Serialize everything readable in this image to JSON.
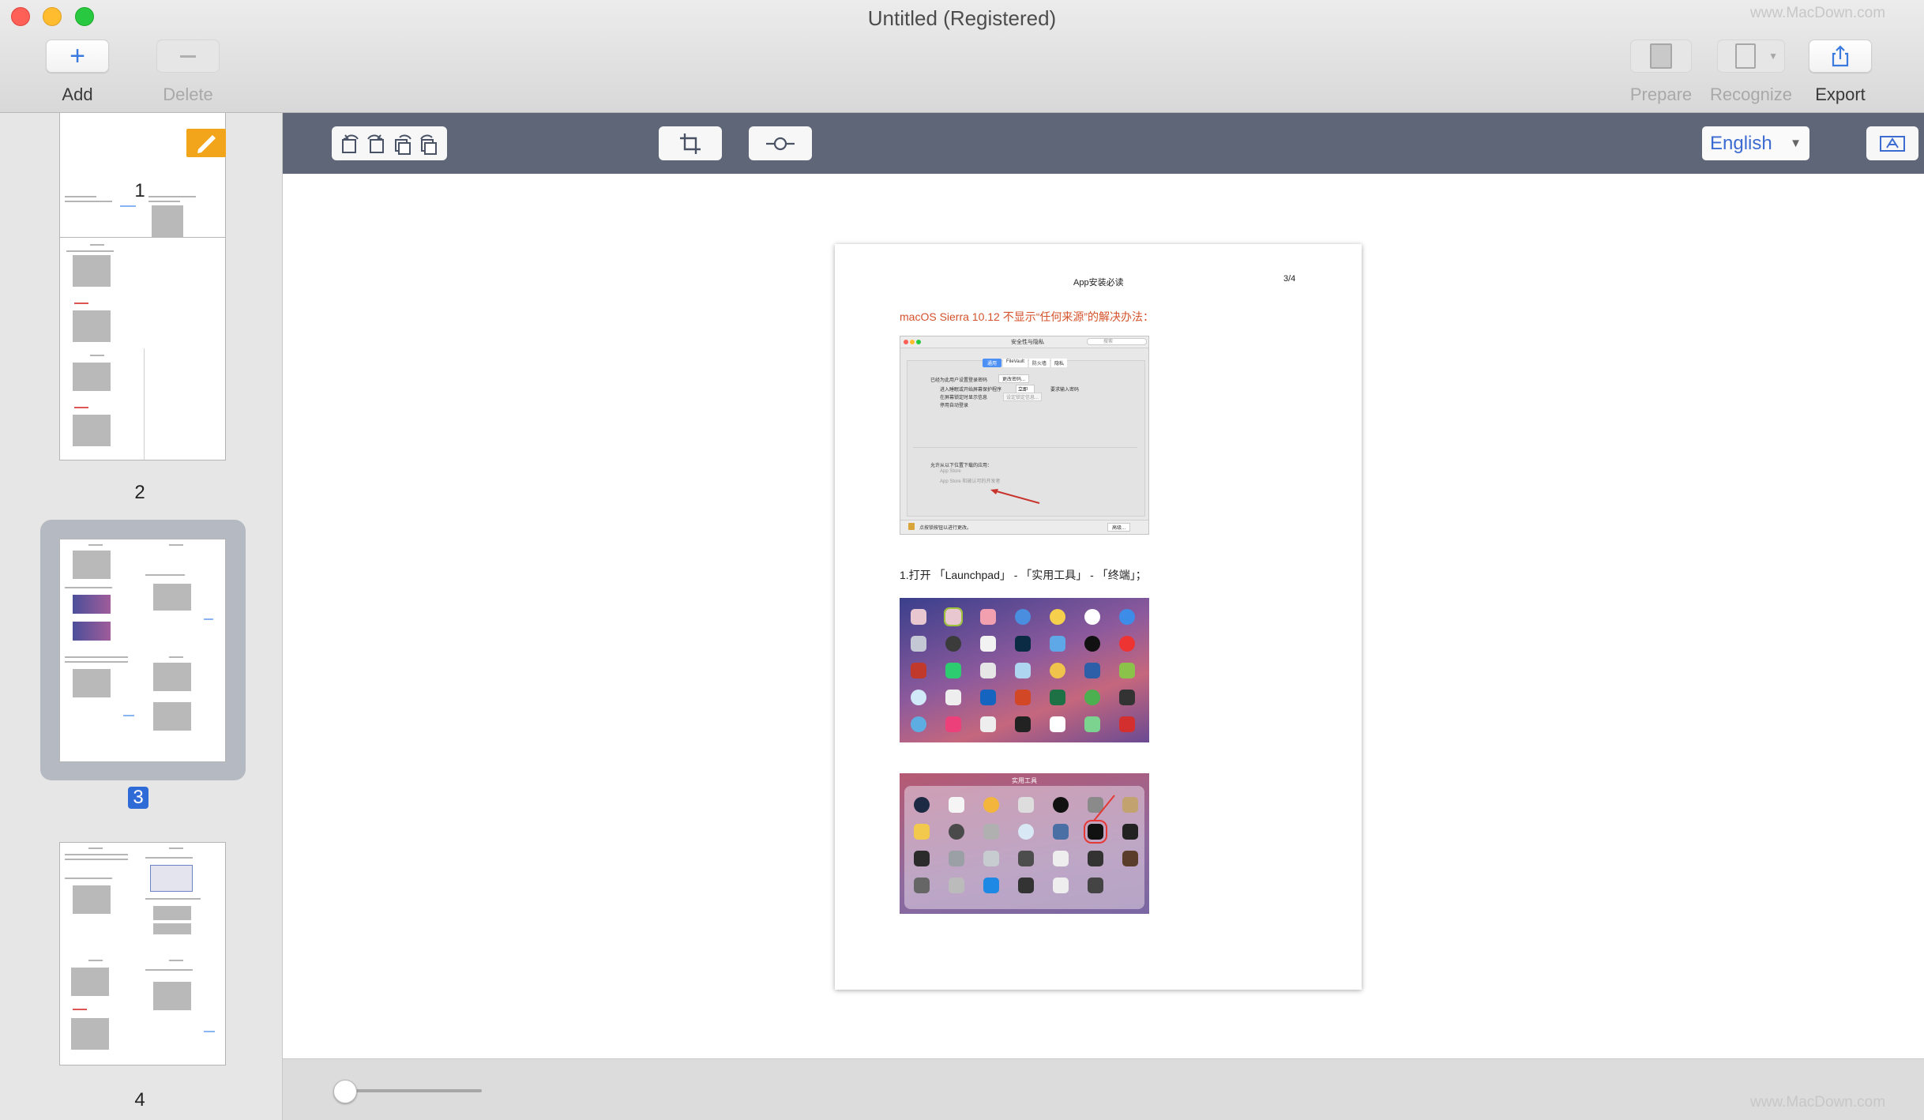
{
  "window": {
    "title": "Untitled (Registered)",
    "watermark": "www.MacDown.com"
  },
  "toolbar": {
    "add_label": "Add",
    "delete_label": "Delete",
    "prepare_label": "Prepare",
    "recognize_label": "Recognize",
    "export_label": "Export"
  },
  "sidebar": {
    "pages": [
      {
        "number": "1",
        "selected": false
      },
      {
        "number": "2",
        "selected": false
      },
      {
        "number": "3",
        "selected": true
      },
      {
        "number": "4",
        "selected": false
      }
    ]
  },
  "editbar": {
    "language": "English"
  },
  "document": {
    "header": "App安装必读",
    "page_indicator": "3/4",
    "heading": "macOS Sierra 10.12 不显示“任何来源”的解决办法：",
    "step1": "1.打开 「Launchpad」 - 「实用工具」 - 「终端」；",
    "shot1": {
      "window_title": "安全性与隐私",
      "search": "搜索",
      "tabs": [
        "通用",
        "FileVault",
        "防火墙",
        "隐私"
      ],
      "line1": "已经为此用户设置登录密码",
      "change_pw": "更改密码...",
      "line2": "进入睡眠或开始屏幕保护程序",
      "immediately": "立即",
      "line2b": "要求输入密码",
      "line3": "在屏幕锁定时显示信息",
      "set_msg": "设定锁定信息...",
      "line4": "停用自动登录",
      "allow_title": "允许从以下位置下载的应用：",
      "opt1": "App Store",
      "opt2": "App Store 和被认可的开发者",
      "lock_text": "点按锁按钮以进行更改。",
      "advanced": "高级..."
    },
    "shot3": {
      "folder_title": "实用工具"
    }
  },
  "colors": {
    "accent": "#2f6bd6",
    "editbar": "#5e6677",
    "heading_red": "#d4522b"
  }
}
